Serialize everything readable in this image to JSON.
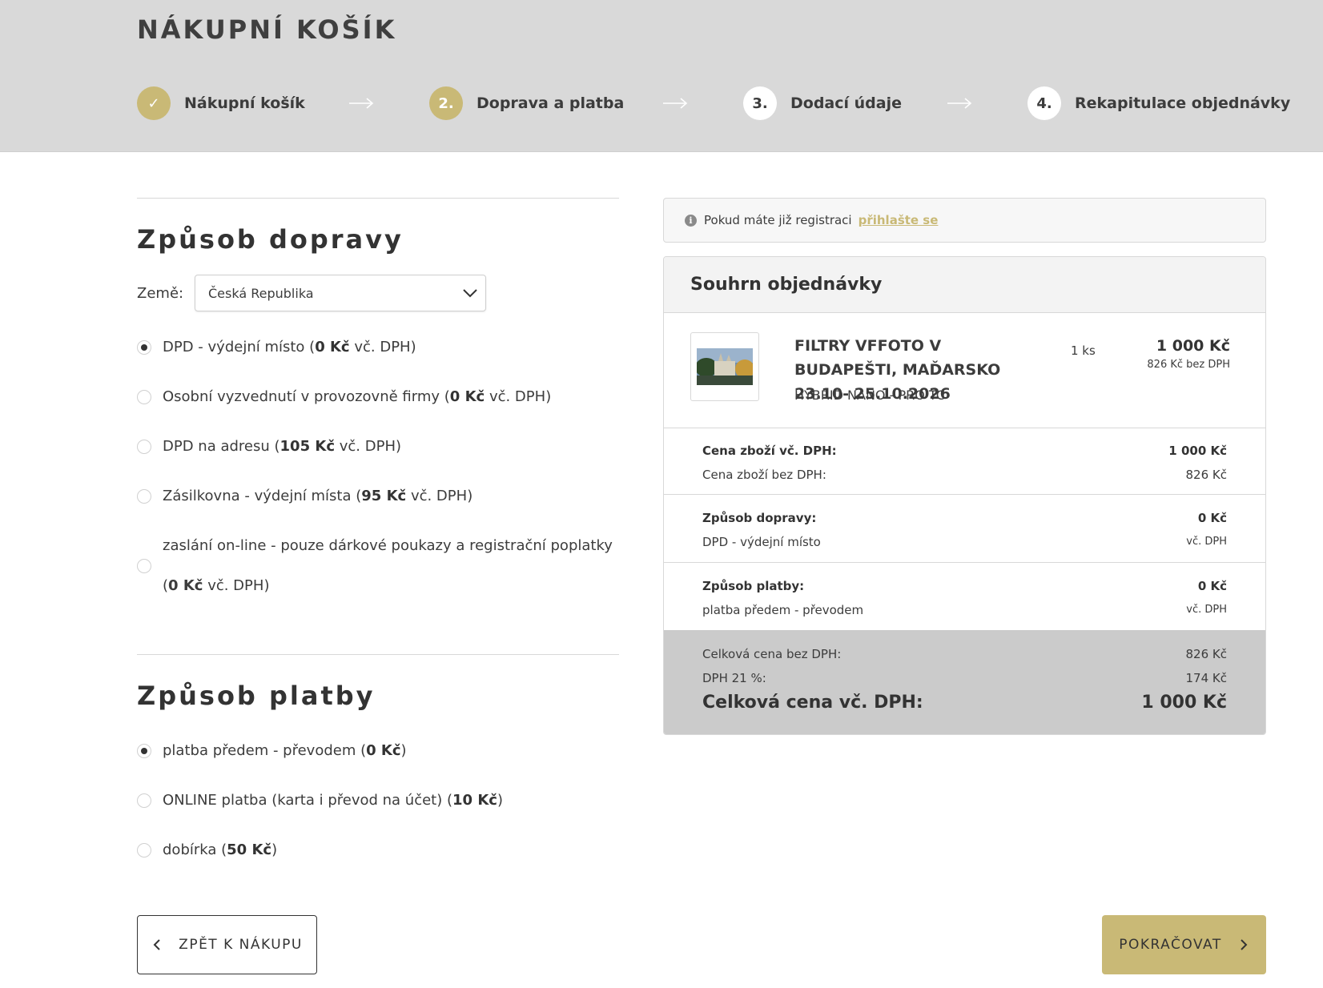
{
  "header": {
    "title": "NÁKUPNÍ KOŠÍK",
    "steps": [
      {
        "marker": "✓",
        "label": "Nákupní košík",
        "state": "done"
      },
      {
        "marker": "2.",
        "label": "Doprava a platba",
        "state": "active"
      },
      {
        "marker": "3.",
        "label": "Dodací údaje",
        "state": "todo"
      },
      {
        "marker": "4.",
        "label": "Rekapitulace objednávky",
        "state": "todo"
      }
    ]
  },
  "shipping": {
    "title": "Způsob dopravy",
    "country_label": "Země:",
    "country_value": "Česká Republika",
    "options": [
      {
        "name": "DPD - výdejní místo",
        "price": "0 Kč",
        "suffix": "vč. DPH",
        "checked": true
      },
      {
        "name": "Osobní vyzvednutí v provozovně firmy",
        "price": "0 Kč",
        "suffix": "vč. DPH",
        "checked": false
      },
      {
        "name": "DPD na adresu",
        "price": "105 Kč",
        "suffix": "vč. DPH",
        "checked": false
      },
      {
        "name": "Zásilkovna - výdejní místa",
        "price": "95 Kč",
        "suffix": "vč. DPH",
        "checked": false
      },
      {
        "name": "zaslání on-line - pouze dárkové poukazy a registrační poplatky",
        "price": "0 Kč",
        "suffix": "vč. DPH",
        "checked": false
      }
    ]
  },
  "payment": {
    "title": "Způsob platby",
    "options": [
      {
        "name": "platba předem - převodem",
        "price": "0 Kč",
        "checked": true
      },
      {
        "name": "ONLINE platba (karta i převod na účet)",
        "price": "10 Kč",
        "checked": false
      },
      {
        "name": "dobírka",
        "price": "50 Kč",
        "checked": false
      }
    ]
  },
  "buttons": {
    "back": "ZPĚT K NÁKUPU",
    "next": "POKRAČOVAT"
  },
  "login": {
    "text": "Pokud máte již registraci",
    "link": "přihlašte se"
  },
  "summary": {
    "title": "Souhrn objednávky",
    "product": {
      "name": "FILTRY VFFOTO V BUDAPEŠTI, MAĎARSKO 23.10- 25.10.2026",
      "variant": "HYBRID NANO - PRO TC",
      "qty": "1 ks",
      "price": "1 000 Kč",
      "price_net": "826 Kč bez DPH"
    },
    "goods_incl_label": "Cena zboží vč. DPH:",
    "goods_incl_value": "1 000 Kč",
    "goods_excl_label": "Cena zboží bez DPH:",
    "goods_excl_value": "826 Kč",
    "shipping_label": "Způsob dopravy:",
    "shipping_value": "0 Kč",
    "shipping_name": "DPD - výdejní místo",
    "shipping_note": "vč. DPH",
    "payment_label": "Způsob platby:",
    "payment_value": "0 Kč",
    "payment_name": "platba předem - převodem",
    "payment_note": "vč. DPH",
    "total_excl_label": "Celková cena bez DPH:",
    "total_excl_value": "826 Kč",
    "vat_label": "DPH 21 %:",
    "vat_value": "174 Kč",
    "total_incl_label": "Celková cena vč. DPH:",
    "total_incl_value": "1 000 Kč"
  },
  "colors": {
    "accent": "#c9b976",
    "header_bg": "#d9d9d9",
    "totals_bg": "#cbcbcb"
  }
}
